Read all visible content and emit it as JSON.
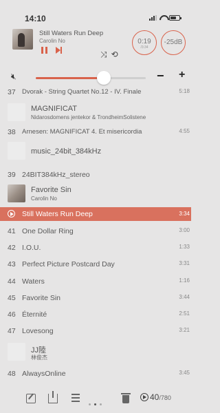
{
  "status_bar": {
    "time": "14:10",
    "icons": [
      "signal-icon",
      "wifi-icon",
      "battery-icon"
    ]
  },
  "now_playing": {
    "title": "Still Waters Run Deep",
    "artist": "Carolin No",
    "elapsed": "0:19",
    "remaining": "/3:34",
    "gain": "-25dB",
    "accent_color": "#d9624b"
  },
  "volume": {
    "level": 0.62,
    "minus_label": "−",
    "plus_label": "+"
  },
  "playlist": {
    "rows": [
      {
        "num": "37",
        "name": "Dvorak - String Quartet No.12 - IV. Finale",
        "dur": "5:18"
      },
      {
        "title": "MAGNIFICAT",
        "subtitle": "Nidarosdomens jentekor & TrondheimSolistene"
      },
      {
        "num": "38",
        "name": "Arnesen: MAGNIFICAT 4. Et misericordia",
        "dur": "4:55"
      },
      {
        "title": "music_24bit_384kHz"
      },
      {
        "num": "39",
        "name": "24BIT384kHz_stereo"
      },
      {
        "title": "Favorite Sin",
        "subtitle": "Carolin No"
      },
      {
        "name": "Still Waters Run Deep",
        "dur": "3:34",
        "selected": true
      },
      {
        "num": "41",
        "name": "One Dollar Ring",
        "dur": "3:00"
      },
      {
        "num": "42",
        "name": "I.O.U.",
        "dur": "1:33"
      },
      {
        "num": "43",
        "name": "Perfect Picture Postcard Day",
        "dur": "3:31"
      },
      {
        "num": "44",
        "name": "Waters",
        "dur": "1:16"
      },
      {
        "num": "45",
        "name": "Favorite Sin",
        "dur": "3:44"
      },
      {
        "num": "46",
        "name": "Éternité",
        "dur": "2:51"
      },
      {
        "num": "47",
        "name": "Lovesong",
        "dur": "3:21"
      },
      {
        "title": "JJ陸",
        "subtitle": "林俊杰"
      },
      {
        "num": "48",
        "name": "AlwaysOnline",
        "dur": "3:45"
      }
    ]
  },
  "bottom_bar": {
    "current": "40",
    "total": "/780"
  }
}
